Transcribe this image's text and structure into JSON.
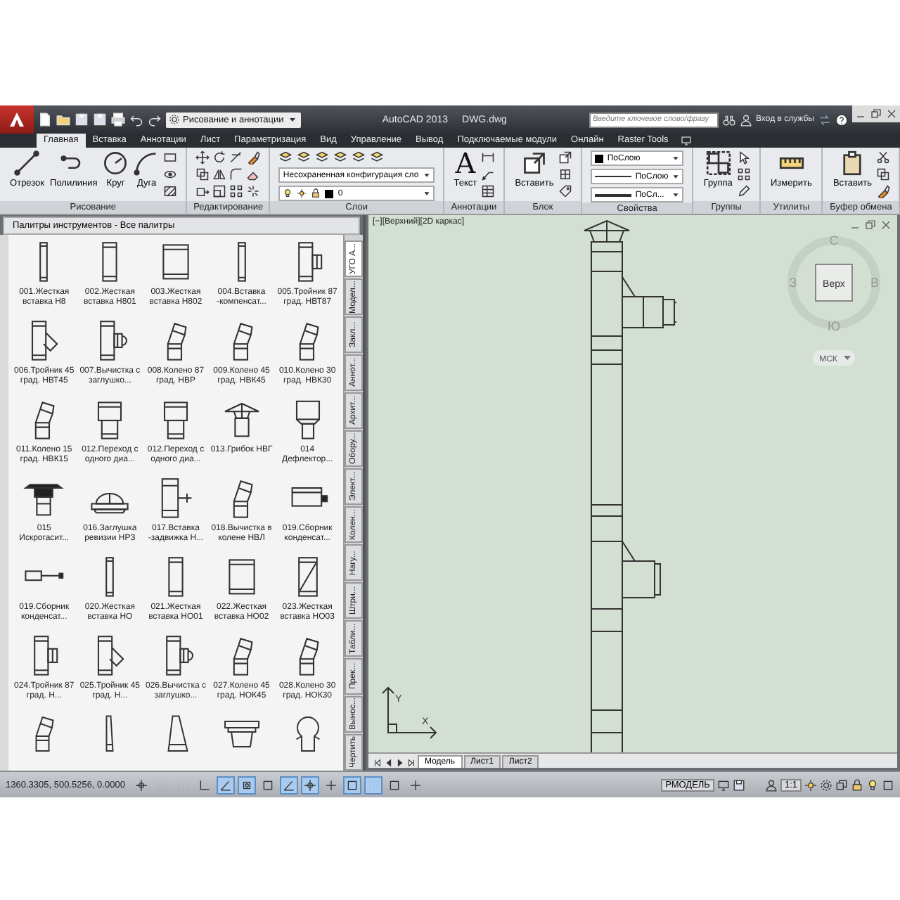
{
  "title_bar": {
    "workspace": "Рисование и аннотации",
    "app_title": "AutoCAD 2013",
    "file_name": "DWG.dwg",
    "search": {
      "placeholder": "Введите ключевое слово/фразу"
    },
    "sign_in": "Вход в службы"
  },
  "ribbon_tabs": [
    {
      "label": "Главная",
      "selected": true
    },
    {
      "label": "Вставка",
      "selected": false
    },
    {
      "label": "Аннотации",
      "selected": false
    },
    {
      "label": "Лист",
      "selected": false
    },
    {
      "label": "Параметризация",
      "selected": false
    },
    {
      "label": "Вид",
      "selected": false
    },
    {
      "label": "Управление",
      "selected": false
    },
    {
      "label": "Вывод",
      "selected": false
    },
    {
      "label": "Подключаемые модули",
      "selected": false
    },
    {
      "label": "Онлайн",
      "selected": false
    },
    {
      "label": "Raster Tools",
      "selected": false
    }
  ],
  "ribbon_panels": [
    {
      "title": "Рисование",
      "items": [
        {
          "kind": "large",
          "label": "Отрезок"
        },
        {
          "kind": "large",
          "label": "Полилиния"
        },
        {
          "kind": "large",
          "label": "Круг"
        },
        {
          "kind": "large",
          "label": "Дуга"
        },
        {
          "kind": "tools"
        }
      ]
    },
    {
      "title": "Редактирование",
      "items": [
        {
          "kind": "tools"
        },
        {
          "kind": "tools"
        },
        {
          "kind": "tools"
        },
        {
          "kind": "tools"
        }
      ]
    },
    {
      "title": "Слои",
      "items": [
        {
          "kind": "layers",
          "combo": "Несохраненная конфигурация сло",
          "layer": "0"
        }
      ]
    },
    {
      "title": "Аннотации",
      "items": [
        {
          "kind": "large",
          "label": "Текст",
          "glyph": "A"
        },
        {
          "kind": "tools"
        }
      ]
    },
    {
      "title": "Блок",
      "items": [
        {
          "kind": "large",
          "label": "Вставить"
        },
        {
          "kind": "tools"
        }
      ]
    },
    {
      "title": "Свойства",
      "items": [
        {
          "kind": "properties",
          "color_setting": "ПоСлою",
          "linetype": "ПоСлою",
          "lineweight": "ПоСл..."
        }
      ]
    },
    {
      "title": "Группы",
      "items": [
        {
          "kind": "large",
          "label": "Группа"
        },
        {
          "kind": "tools"
        }
      ]
    },
    {
      "title": "Утилиты",
      "items": [
        {
          "kind": "large",
          "label": "Измерить"
        }
      ]
    },
    {
      "title": "Буфер обмена",
      "items": [
        {
          "kind": "large",
          "label": "Вставить"
        },
        {
          "kind": "tools"
        }
      ]
    }
  ],
  "palette": {
    "title": "Палитры инструментов - Все палитры",
    "items": [
      {
        "label": "001.Жесткая вставка Н8",
        "kind": "pipe_thin"
      },
      {
        "label": "002.Жесткая вставка Н801",
        "kind": "pipe"
      },
      {
        "label": "003.Жесткая вставка Н802",
        "kind": "pipe_wide"
      },
      {
        "label": "004.Вставка -компенсат...",
        "kind": "pipe_thin"
      },
      {
        "label": "005.Тройник 87 град. НВТ87",
        "kind": "tee"
      },
      {
        "label": "006.Тройник 45 град. НВТ45",
        "kind": "tee45"
      },
      {
        "label": "007.Вычистка с заглушко...",
        "kind": "tee_cap"
      },
      {
        "label": "008.Колено 87 град. НВР",
        "kind": "elbow"
      },
      {
        "label": "009.Колено 45 град. НВК45",
        "kind": "elbow"
      },
      {
        "label": "010.Колено 30 град. НВК30",
        "kind": "elbow"
      },
      {
        "label": "011.Колено 15 град. НВК15",
        "kind": "elbow"
      },
      {
        "label": "012.Переход с одного диа...",
        "kind": "reducer"
      },
      {
        "label": "012.Переход с одного диа...",
        "kind": "reducer"
      },
      {
        "label": "013.Грибок НВГ",
        "kind": "cap"
      },
      {
        "label": "014 Дефлектор...",
        "kind": "deflector"
      },
      {
        "label": "015 Искрогасит...",
        "kind": "spark"
      },
      {
        "label": "016.Заглушка ревизии НРЗ",
        "kind": "dome"
      },
      {
        "label": "017.Вставка -задвижка Н...",
        "kind": "valve"
      },
      {
        "label": "018.Вычистка в колене НВЛ",
        "kind": "elbow"
      },
      {
        "label": "019.Сборник конденсат...",
        "kind": "box"
      },
      {
        "label": "019.Сборник конденсат...",
        "kind": "drain"
      },
      {
        "label": "020.Жесткая вставка НО",
        "kind": "pipe_thin"
      },
      {
        "label": "021.Жесткая вставка НО01",
        "kind": "pipe"
      },
      {
        "label": "022.Жесткая вставка НО02",
        "kind": "pipe_wide"
      },
      {
        "label": "023.Жесткая вставка НО03",
        "kind": "pipe_diag"
      },
      {
        "label": "024.Тройник 87 град. Н...",
        "kind": "tee"
      },
      {
        "label": "025.Тройник 45 град. Н...",
        "kind": "tee45"
      },
      {
        "label": "026.Вычистка с заглушко...",
        "kind": "tee_cap"
      },
      {
        "label": "027.Колено 45 град. НОК45",
        "kind": "elbow"
      },
      {
        "label": "028.Колено 30 град. НОК30",
        "kind": "elbow"
      }
    ],
    "tail_items": [
      {
        "kind": "elbow"
      },
      {
        "kind": "taper_thin"
      },
      {
        "kind": "taper"
      },
      {
        "kind": "flange"
      },
      {
        "kind": "omega"
      }
    ],
    "tabs": [
      {
        "label": "УГО А...",
        "selected": true
      },
      {
        "label": "Модел...",
        "selected": false
      },
      {
        "label": "Закл...",
        "selected": false
      },
      {
        "label": "Аннот...",
        "selected": false
      },
      {
        "label": "Архит...",
        "selected": false
      },
      {
        "label": "Обору...",
        "selected": false
      },
      {
        "label": "Элект...",
        "selected": false
      },
      {
        "label": "Колен...",
        "selected": false
      },
      {
        "label": "Нагу...",
        "selected": false
      },
      {
        "label": "Штри...",
        "selected": false
      },
      {
        "label": "Табли...",
        "selected": false
      },
      {
        "label": "Прек...",
        "selected": false
      },
      {
        "label": "Вынос...",
        "selected": false
      },
      {
        "label": "Чертить",
        "selected": false
      }
    ]
  },
  "viewport": {
    "view_label": "[−][Верхний][2D каркас]",
    "view_cube": {
      "face": "Верх",
      "north": "С",
      "east": "В",
      "south": "Ю",
      "west": "З",
      "ucs": "МСК"
    },
    "ucs_icon": {
      "x_label": "X",
      "y_label": "Y"
    },
    "layout_tabs": [
      {
        "label": "Модель",
        "selected": true
      },
      {
        "label": "Лист1",
        "selected": false
      },
      {
        "label": "Лист2",
        "selected": false
      }
    ]
  },
  "status_bar": {
    "coordinates": "1360.3305, 500.5256, 0.0000",
    "toggles": [
      {
        "on": false
      },
      {
        "on": false
      },
      {
        "on": false
      },
      {
        "on": false
      },
      {
        "on": true
      },
      {
        "on": true
      },
      {
        "on": false
      },
      {
        "on": true
      },
      {
        "on": true
      },
      {
        "on": false
      },
      {
        "on": true
      },
      {
        "on": true
      },
      {
        "on": false
      },
      {
        "on": false
      }
    ],
    "space": "РМОДЕЛЬ",
    "scale": "1:1"
  }
}
